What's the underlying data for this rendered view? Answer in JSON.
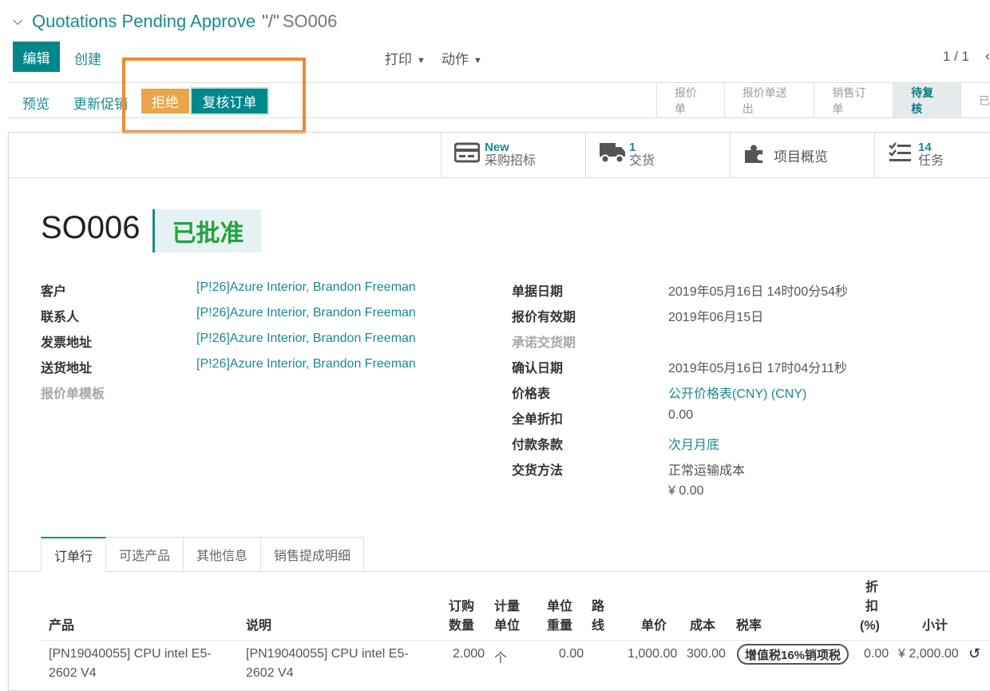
{
  "breadcrumb": {
    "title": "Quotations Pending Approve",
    "separator": "\"/\"",
    "current": "SO006"
  },
  "toolbar": {
    "edit": "编辑",
    "create": "创建",
    "print": "打印",
    "action": "动作",
    "pager": "1 / 1"
  },
  "statusbar": {
    "preview": "预览",
    "update_promo": "更新促销",
    "reject": "拒绝",
    "review": "复核订单",
    "stages": [
      "报价单",
      "报价单送出",
      "销售订单",
      "待复核",
      "已"
    ],
    "active_stage": "待复核"
  },
  "smart_buttons": [
    {
      "icon": "purchase-tender-icon",
      "number": "New",
      "label": "采购招标"
    },
    {
      "icon": "truck-icon",
      "number": "1",
      "label": "交货"
    },
    {
      "icon": "puzzle-icon",
      "number": "",
      "label": "项目概览"
    },
    {
      "icon": "tasks-icon",
      "number": "14",
      "label": "任务"
    }
  ],
  "record": {
    "name": "SO006",
    "state": "已批准"
  },
  "left_fields": [
    {
      "label": "客户",
      "value": "[P!26]Azure Interior, Brandon Freeman"
    },
    {
      "label": "联系人",
      "value": "[P!26]Azure Interior, Brandon Freeman"
    },
    {
      "label": "发票地址",
      "value": "[P!26]Azure Interior, Brandon Freeman"
    },
    {
      "label": "送货地址",
      "value": "[P!26]Azure Interior, Brandon Freeman"
    },
    {
      "label": "报价单模板",
      "value": ""
    }
  ],
  "right_fields": [
    {
      "label": "单据日期",
      "value": "2019年05月16日 14时00分54秒"
    },
    {
      "label": "报价有效期",
      "value": "2019年06月15日"
    },
    {
      "label": "承诺交货期",
      "value": ""
    },
    {
      "label": "确认日期",
      "value": "2019年05月16日 17时04分11秒"
    },
    {
      "label": "价格表",
      "value": "公开价格表(CNY) (CNY)"
    },
    {
      "label": "全单折扣",
      "value": "0.00"
    },
    {
      "label": "付款条款",
      "value": "次月月底"
    },
    {
      "label": "交货方法",
      "value": "正常运输成本"
    }
  ],
  "delivery_cost": "¥ 0.00",
  "tabs": [
    "订单行",
    "可选产品",
    "其他信息",
    "销售提成明细"
  ],
  "table": {
    "headers": {
      "product": "产品",
      "desc": "说明",
      "qty1": "订购",
      "qty2": "数量",
      "uom1": "计量",
      "uom2": "单位",
      "wt1": "单位",
      "wt2": "重量",
      "route1": "路",
      "route2": "线",
      "price": "单价",
      "cost": "成本",
      "tax": "税率",
      "disc1": "折",
      "disc2": "扣",
      "disc3": "(%)",
      "subtotal": "小计"
    },
    "row": {
      "product1": "[PN19040055] CPU intel E5-",
      "product2": "2602 V4",
      "desc1": "[PN19040055] CPU intel E5-",
      "desc2": "2602 V4",
      "qty": "2.000",
      "uom": "个",
      "weight": "0.00",
      "price": "1,000.00",
      "cost": "300.00",
      "tax": "增值税16%销项税",
      "discount": "0.00",
      "subtotal": "¥ 2,000.00"
    }
  }
}
